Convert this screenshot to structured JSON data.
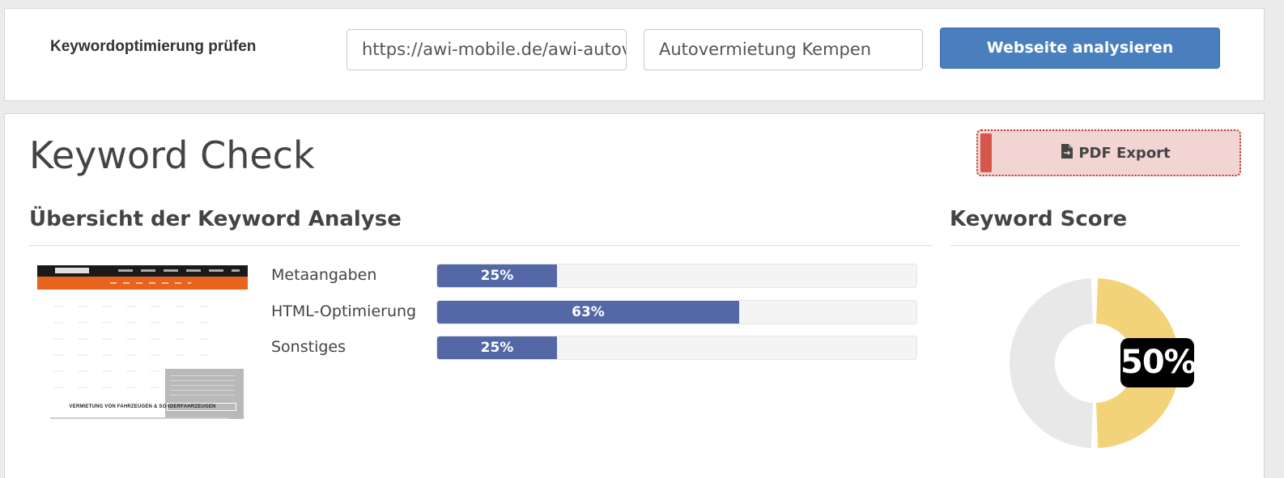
{
  "top_bar": {
    "title": "Keywordoptimierung prüfen",
    "url_value": "https://awi-mobile.de/awi-autovermietung-kempen/",
    "keyword_value": "Autovermietung Kempen",
    "analyze_button": "Webseite analysieren"
  },
  "main": {
    "page_title": "Keyword Check",
    "pdf_button": "PDF Export",
    "overview_title": "Übersicht der Keyword Analyse",
    "score_title": "Keyword Score",
    "thumbnail": {
      "tagline": "VERMIETUNG VON FAHRZEUGEN & SONDERFAHRZEUGEN"
    },
    "metrics": [
      {
        "label": "Metaangaben",
        "value": 25,
        "display": "25%"
      },
      {
        "label": "HTML-Optimierung",
        "value": 63,
        "display": "63%"
      },
      {
        "label": "Sonstiges",
        "value": 25,
        "display": "25%"
      }
    ],
    "score": {
      "value": 50,
      "display": "50%"
    }
  },
  "colors": {
    "primary_button": "#4a7fbd",
    "bar_fill": "#5468a8",
    "score_fill": "#f3d37a",
    "score_empty": "#e8e8e8",
    "pdf_accent": "#d4574a"
  },
  "icons": {
    "pdf": "file-export-icon",
    "thumbnail": "website-screenshot"
  }
}
